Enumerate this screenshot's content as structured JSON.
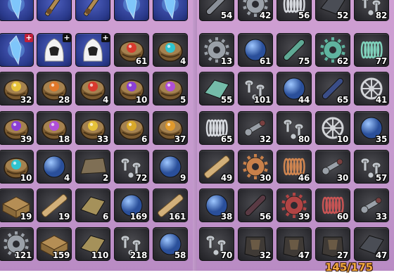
{
  "colors": {
    "panel_bg": "#c89dd0",
    "slot_bg": "#2f2f34",
    "special_slot_bg": "#2a3a8c",
    "quantity_text": "#ffffff",
    "capacity_text": "#f2a840"
  },
  "inventory": {
    "capacity_label": "145/175",
    "left_grid": [
      {
        "icon": "lightning-shard-icon",
        "special": true,
        "badge": "plus",
        "qty": ""
      },
      {
        "icon": "sword-icon",
        "special": true,
        "badge": "",
        "qty": ""
      },
      {
        "icon": "gauntlet-weapon-icon",
        "special": true,
        "badge": "",
        "qty": ""
      },
      {
        "icon": "ice-crystal-orb-icon",
        "special": true,
        "badge": "plus-red",
        "qty": ""
      },
      {
        "icon": "ice-crystal-shard-icon",
        "special": true,
        "badge": "",
        "qty": ""
      },
      {
        "icon": "ice-crystal-cluster-icon",
        "special": true,
        "badge": "plus-red",
        "qty": ""
      },
      {
        "icon": "white-hood-armor-icon",
        "special": true,
        "badge": "plus",
        "qty": ""
      },
      {
        "icon": "white-gloves-icon",
        "special": true,
        "badge": "plus-dark",
        "qty": ""
      },
      {
        "icon": "materia-orb-red-icon",
        "special": false,
        "badge": "",
        "qty": "61"
      },
      {
        "icon": "materia-orb-cyan-icon",
        "special": false,
        "badge": "",
        "qty": "4"
      },
      {
        "icon": "materia-orb-yellow-icon",
        "special": false,
        "badge": "",
        "qty": "32"
      },
      {
        "icon": "materia-orb-orange-icon",
        "special": false,
        "badge": "",
        "qty": "28"
      },
      {
        "icon": "materia-orb-red-icon",
        "special": false,
        "badge": "",
        "qty": "4"
      },
      {
        "icon": "materia-orb-purple-icon",
        "special": false,
        "badge": "",
        "qty": "10"
      },
      {
        "icon": "materia-orb-violet-icon",
        "special": false,
        "badge": "",
        "qty": "5"
      },
      {
        "icon": "materia-orb-purple-icon",
        "special": false,
        "badge": "",
        "qty": "39"
      },
      {
        "icon": "materia-orb-violet-icon",
        "special": false,
        "badge": "",
        "qty": "18"
      },
      {
        "icon": "materia-orb-yellow-icon",
        "special": false,
        "badge": "",
        "qty": "33"
      },
      {
        "icon": "materia-orb-gold-icon",
        "special": false,
        "badge": "",
        "qty": "6"
      },
      {
        "icon": "materia-orb-amber-icon",
        "special": false,
        "badge": "",
        "qty": "37"
      },
      {
        "icon": "materia-orb-cyan-icon",
        "special": false,
        "badge": "",
        "qty": "10"
      },
      {
        "icon": "blue-globe-icon",
        "special": false,
        "badge": "",
        "qty": "4"
      },
      {
        "icon": "stone-slab-icon",
        "special": false,
        "badge": "",
        "qty": "2"
      },
      {
        "icon": "screws-bolts-icon",
        "special": false,
        "badge": "",
        "qty": "72"
      },
      {
        "icon": "red-sphere-icon",
        "special": false,
        "badge": "",
        "qty": "9"
      },
      {
        "icon": "wooden-crate-icon",
        "special": false,
        "badge": "",
        "qty": "19"
      },
      {
        "icon": "lumber-plank-icon",
        "special": false,
        "badge": "",
        "qty": "19"
      },
      {
        "icon": "bronze-plate-icon",
        "special": false,
        "badge": "",
        "qty": "6"
      },
      {
        "icon": "red-sphere-icon",
        "special": false,
        "badge": "",
        "qty": "169"
      },
      {
        "icon": "lumber-plank-icon",
        "special": false,
        "badge": "",
        "qty": "161"
      },
      {
        "icon": "cog-gear-icon",
        "special": false,
        "badge": "",
        "qty": "121"
      },
      {
        "icon": "wooden-crate-icon",
        "special": false,
        "badge": "",
        "qty": "159"
      },
      {
        "icon": "bronze-plate-icon",
        "special": false,
        "badge": "",
        "qty": "110"
      },
      {
        "icon": "screws-bolts-icon",
        "special": false,
        "badge": "",
        "qty": "218"
      },
      {
        "icon": "dark-sphere-icon",
        "special": false,
        "badge": "",
        "qty": "58"
      }
    ],
    "right_grid": [
      {
        "icon": "iron-rod-icon",
        "qty": "54"
      },
      {
        "icon": "steel-cog-icon",
        "qty": "42"
      },
      {
        "icon": "steel-spring-icon",
        "qty": "56"
      },
      {
        "icon": "iron-plate-icon",
        "qty": "52"
      },
      {
        "icon": "screws-bolts-icon",
        "qty": "82"
      },
      {
        "icon": "steel-cog-icon",
        "qty": "13"
      },
      {
        "icon": "teal-sphere-icon",
        "qty": "61"
      },
      {
        "icon": "teal-rod-icon",
        "qty": "75"
      },
      {
        "icon": "teal-cog-icon",
        "qty": "62"
      },
      {
        "icon": "teal-spring-icon",
        "qty": "77"
      },
      {
        "icon": "teal-plate-icon",
        "qty": "55"
      },
      {
        "icon": "screws-bolts-icon",
        "qty": "101"
      },
      {
        "icon": "silver-sphere-icon",
        "qty": "44"
      },
      {
        "icon": "navy-rod-icon",
        "qty": "65"
      },
      {
        "icon": "wheel-gear-icon",
        "qty": "41"
      },
      {
        "icon": "silver-spring-icon",
        "qty": "65"
      },
      {
        "icon": "wrench-parts-icon",
        "qty": "32"
      },
      {
        "icon": "screws-bolts-icon",
        "qty": "80"
      },
      {
        "icon": "wheel-gear-icon",
        "qty": "10"
      },
      {
        "icon": "copper-sphere-icon",
        "qty": "35"
      },
      {
        "icon": "lumber-plank-icon",
        "qty": "49"
      },
      {
        "icon": "copper-cog-icon",
        "qty": "30"
      },
      {
        "icon": "copper-spring-icon",
        "qty": "46"
      },
      {
        "icon": "wrench-parts-icon",
        "qty": "30"
      },
      {
        "icon": "screws-bolts-icon",
        "qty": "57"
      },
      {
        "icon": "dark-sphere-icon",
        "qty": "38"
      },
      {
        "icon": "dark-rod-icon",
        "qty": "56"
      },
      {
        "icon": "red-cog-icon",
        "qty": "39"
      },
      {
        "icon": "red-spring-icon",
        "qty": "60"
      },
      {
        "icon": "wrench-parts-icon",
        "qty": "33"
      },
      {
        "icon": "screws-bolts-icon",
        "qty": "70"
      },
      {
        "icon": "helmet-armor-icon",
        "qty": "32"
      },
      {
        "icon": "dark-armor-icon",
        "qty": "47"
      },
      {
        "icon": "dark-gloves-icon",
        "qty": "27"
      },
      {
        "icon": "dark-chestplate-icon",
        "qty": "47"
      }
    ]
  }
}
